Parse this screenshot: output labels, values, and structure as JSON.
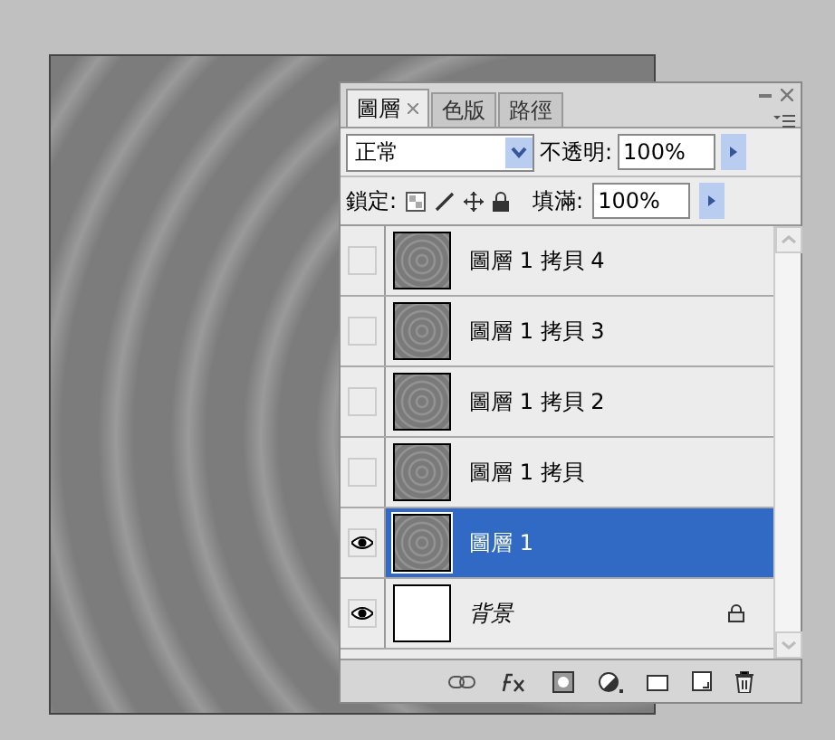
{
  "tabs": [
    {
      "label": "圖層",
      "selected": true
    },
    {
      "label": "色版",
      "selected": false
    },
    {
      "label": "路徑",
      "selected": false
    }
  ],
  "blend_mode": {
    "value": "正常"
  },
  "opacity": {
    "label": "不透明:",
    "value": "100%"
  },
  "lock": {
    "label": "鎖定:"
  },
  "fill": {
    "label": "填滿:",
    "value": "100%"
  },
  "layers": [
    {
      "name": "圖層 1 拷貝 4",
      "kind": "rings",
      "visible": false,
      "selected": false,
      "locked": false
    },
    {
      "name": "圖層 1 拷貝 3",
      "kind": "rings",
      "visible": false,
      "selected": false,
      "locked": false
    },
    {
      "name": "圖層 1 拷貝 2",
      "kind": "rings",
      "visible": false,
      "selected": false,
      "locked": false
    },
    {
      "name": "圖層 1 拷貝",
      "kind": "rings",
      "visible": false,
      "selected": false,
      "locked": false
    },
    {
      "name": "圖層 1",
      "kind": "rings",
      "visible": true,
      "selected": true,
      "locked": false
    },
    {
      "name": "背景",
      "kind": "background",
      "visible": true,
      "selected": false,
      "locked": true
    }
  ]
}
